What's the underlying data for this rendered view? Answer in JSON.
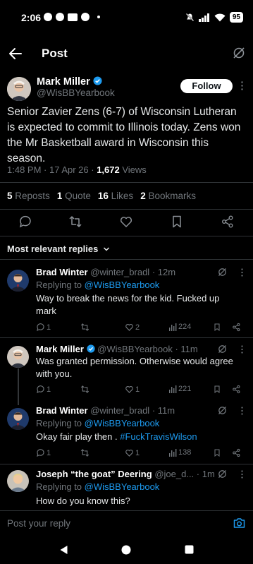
{
  "status": {
    "time": "2:06",
    "battery": "95"
  },
  "header": {
    "title": "Post"
  },
  "post": {
    "author_name": "Mark Miller",
    "author_handle": "@WisBBYearbook",
    "follow_label": "Follow",
    "text": "Senior Zavier Zens (6-7) of Wisconsin Lutheran is expected to commit to Illinois today. Zens won the Mr Basketball award in Wisconsin this season.",
    "time": "1:48 PM · 17 Apr 26 · ",
    "views_count": "1,672",
    "views_label": " Views",
    "stats": {
      "reposts_count": "5",
      "reposts_label": "Reposts",
      "quotes_count": "1",
      "quotes_label": "Quote",
      "likes_count": "16",
      "likes_label": "Likes",
      "bookmarks_count": "2",
      "bookmarks_label": "Bookmarks"
    }
  },
  "replies_filter": "Most relevant replies",
  "replies": [
    {
      "name": "Brad Winter",
      "handle": "@winter_bradl",
      "time": "· 12m",
      "replying_prefix": "Replying to ",
      "replying_to": "@WisBBYearbook",
      "text": "Way to break the news for the kid. Fucked up mark",
      "replies": "1",
      "likes": "2",
      "views": "224"
    },
    {
      "name": "Mark Miller",
      "handle": "@WisBBYearbook",
      "time": "· 11m",
      "text": "Was granted permission. Otherwise would agree with you.",
      "replies": "1",
      "likes": "1",
      "views": "221"
    },
    {
      "name": "Brad Winter",
      "handle": "@winter_bradl",
      "time": "· 11m",
      "replying_prefix": "Replying to ",
      "replying_to": "@WisBBYearbook",
      "text_prefix": "Okay fair play then . ",
      "text_hashtag": "#FuckTravisWilson",
      "replies": "1",
      "likes": "1",
      "views": "138"
    },
    {
      "name": "Joseph “the goat” Deering",
      "handle": "@joe_d...",
      "time": "· 1m",
      "replying_prefix": "Replying to ",
      "replying_to": "@WisBBYearbook",
      "text": "How do you know this?"
    }
  ],
  "composer": {
    "placeholder": "Post your reply"
  },
  "colors": {
    "background": "#000000",
    "text": "#e7e9ea",
    "muted": "#71767b",
    "accent": "#1d9bf0",
    "divider": "#2f3336"
  }
}
